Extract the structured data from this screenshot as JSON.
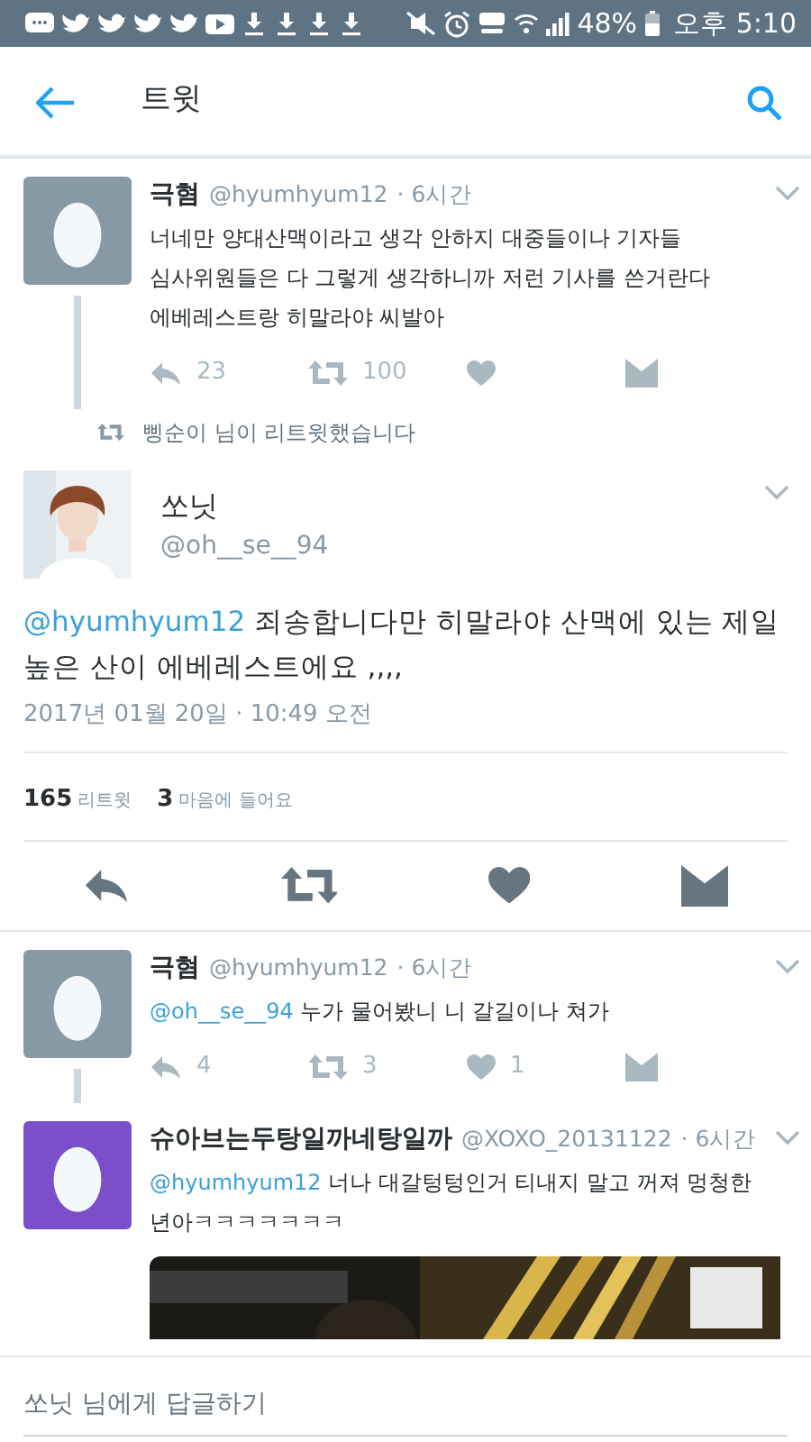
{
  "status_bar": {
    "battery": "48%",
    "time": "오후 5:10"
  },
  "header": {
    "title": "트윗"
  },
  "parent_tweet": {
    "name": "극혐",
    "handle": "@hyumhyum12",
    "time": "· 6시간",
    "avatar": {
      "kind": "egg",
      "color": "#8899a6"
    },
    "text": "너네만 양대산맥이라고 생각 안하지 대중들이나 기자들\n심사위원들은 다 그렇게 생각하니까 저런 기사를 쓴거란다\n에베레스트랑 히말라야 씨발아",
    "actions": [
      {
        "kind": "reply",
        "count": "23"
      },
      {
        "kind": "retweet",
        "count": "100"
      },
      {
        "kind": "like"
      },
      {
        "kind": "message"
      }
    ]
  },
  "retweet_note": "삥순이 님이 리트윗했습니다",
  "focused_tweet": {
    "name": "쏘닛",
    "handle": "@oh__se__94",
    "mention": "@hyumhyum12",
    "text": "죄송합니다만 히말라야 산맥에 있는 제일\n높은 산이 에베레스트에요 ,,,,",
    "date": "2017년 01월 20일 · 10:49 오전",
    "stats": [
      {
        "count": "165",
        "label": "리트윗"
      },
      {
        "count": "3",
        "label": "마음에 들어요"
      }
    ],
    "actions": [
      {
        "kind": "reply"
      },
      {
        "kind": "retweet"
      },
      {
        "kind": "like"
      },
      {
        "kind": "message"
      }
    ]
  },
  "replies": [
    {
      "name": "극혐",
      "handle": "@hyumhyum12",
      "time": "· 6시간",
      "avatar": {
        "kind": "egg",
        "color": "#8899a6"
      },
      "mention": "@oh__se__94",
      "text": "누가 물어봤니 니 갈길이나 쳐가",
      "thread_line": true,
      "actions": [
        {
          "kind": "reply",
          "count": "4"
        },
        {
          "kind": "retweet",
          "count": "3"
        },
        {
          "kind": "like",
          "count": "1"
        },
        {
          "kind": "message"
        }
      ]
    },
    {
      "name": "슈아브는두탕일까네탕일까",
      "handle": "@XOXO_20131122",
      "time": "· 6시간",
      "avatar": {
        "kind": "egg",
        "color": "#7b4fc9"
      },
      "mention": "@hyumhyum12",
      "text": "너나 대갈텅텅인거 티내지 말고 꺼져 멍청한\n년아ㅋㅋㅋㅋㅋㅋㅋ",
      "thread_line": false
    }
  ],
  "reply_box": {
    "placeholder": "쏘닛 님에게 답글하기"
  }
}
